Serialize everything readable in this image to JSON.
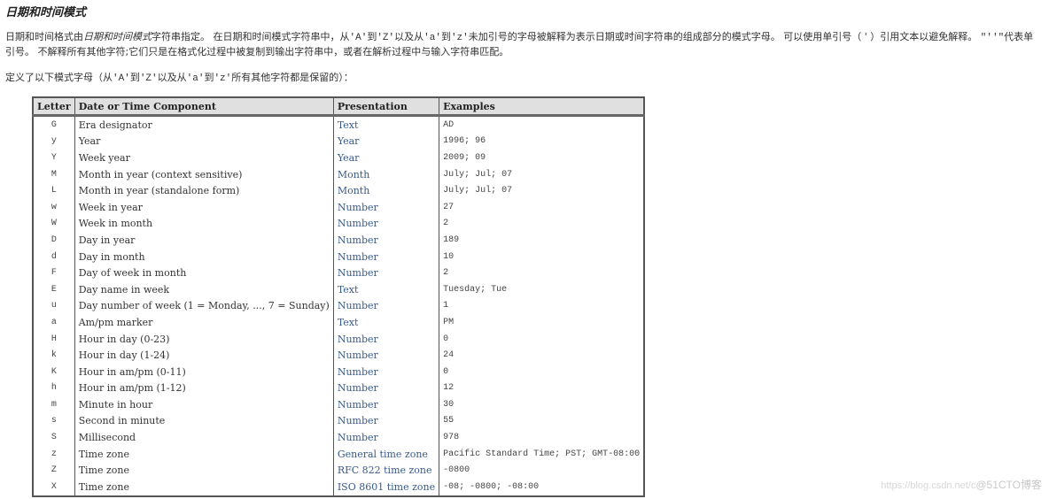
{
  "section_title": "日期和时间模式",
  "intro": {
    "part1": "日期和时间格式由",
    "em": "日期和时间模式",
    "part2": "字符串指定。 在日期和时间模式字符串中，从",
    "code_A": "'A'",
    "to1": "到",
    "code_Z": "'Z'",
    "and_from": "以及从",
    "code_a": "'a'",
    "to2": "到",
    "code_z": "'z'",
    "part3": "未加引号的字母被解释为表示日期或时间字符串的组成部分的模式字母。 可以使用单引号（ ' ）引用文本以避免解释。",
    "code_quotes": "\"''\"",
    "part4": "代表单引号。 不解释所有其他字符;它们只是在格式化过程中被复制到输出字符串中，或者在解析过程中与输入字符串匹配。"
  },
  "defined": {
    "part1": "定义了以下模式字母（从",
    "code_A": "'A'",
    "to1": "到",
    "code_Z": "'Z'",
    "and_from": "以及从",
    "code_a": "'a'",
    "to2": "到",
    "code_z": "'z'",
    "part2": "所有其他字符都是保留的）："
  },
  "table": {
    "headers": [
      "Letter",
      "Date or Time Component",
      "Presentation",
      "Examples"
    ],
    "rows": [
      {
        "letter": "G",
        "component": "Era designator",
        "presentation": "Text",
        "examples": "AD"
      },
      {
        "letter": "y",
        "component": "Year",
        "presentation": "Year",
        "examples": "1996; 96"
      },
      {
        "letter": "Y",
        "component": "Week year",
        "presentation": "Year",
        "examples": "2009; 09"
      },
      {
        "letter": "M",
        "component": "Month in year (context sensitive)",
        "presentation": "Month",
        "examples": "July; Jul; 07"
      },
      {
        "letter": "L",
        "component": "Month in year (standalone form)",
        "presentation": "Month",
        "examples": "July; Jul; 07"
      },
      {
        "letter": "w",
        "component": "Week in year",
        "presentation": "Number",
        "examples": "27"
      },
      {
        "letter": "W",
        "component": "Week in month",
        "presentation": "Number",
        "examples": "2"
      },
      {
        "letter": "D",
        "component": "Day in year",
        "presentation": "Number",
        "examples": "189"
      },
      {
        "letter": "d",
        "component": "Day in month",
        "presentation": "Number",
        "examples": "10"
      },
      {
        "letter": "F",
        "component": "Day of week in month",
        "presentation": "Number",
        "examples": "2"
      },
      {
        "letter": "E",
        "component": "Day name in week",
        "presentation": "Text",
        "examples": "Tuesday; Tue"
      },
      {
        "letter": "u",
        "component": "Day number of week (1 = Monday, ..., 7 = Sunday)",
        "presentation": "Number",
        "examples": "1"
      },
      {
        "letter": "a",
        "component": "Am/pm marker",
        "presentation": "Text",
        "examples": "PM"
      },
      {
        "letter": "H",
        "component": "Hour in day (0-23)",
        "presentation": "Number",
        "examples": "0"
      },
      {
        "letter": "k",
        "component": "Hour in day (1-24)",
        "presentation": "Number",
        "examples": "24"
      },
      {
        "letter": "K",
        "component": "Hour in am/pm (0-11)",
        "presentation": "Number",
        "examples": "0"
      },
      {
        "letter": "h",
        "component": "Hour in am/pm (1-12)",
        "presentation": "Number",
        "examples": "12"
      },
      {
        "letter": "m",
        "component": "Minute in hour",
        "presentation": "Number",
        "examples": "30"
      },
      {
        "letter": "s",
        "component": "Second in minute",
        "presentation": "Number",
        "examples": "55"
      },
      {
        "letter": "S",
        "component": "Millisecond",
        "presentation": "Number",
        "examples": "978"
      },
      {
        "letter": "z",
        "component": "Time zone",
        "presentation": "General time zone",
        "examples": "Pacific Standard Time; PST; GMT-08:00"
      },
      {
        "letter": "Z",
        "component": "Time zone",
        "presentation": "RFC 822 time zone",
        "examples": "-0800"
      },
      {
        "letter": "X",
        "component": "Time zone",
        "presentation": "ISO 8601 time zone",
        "examples": "-08; -0800; -08:00"
      }
    ]
  },
  "watermark": {
    "url": "https://blog.csdn.net/c",
    "brand": "@51CTO博客"
  }
}
